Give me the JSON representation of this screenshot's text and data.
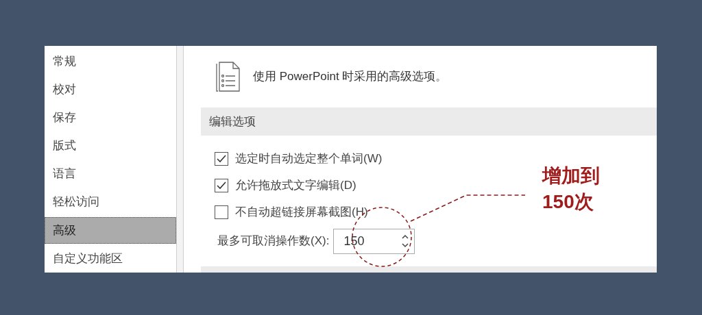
{
  "sidebar": {
    "items": [
      {
        "label": "常规",
        "selected": false
      },
      {
        "label": "校对",
        "selected": false
      },
      {
        "label": "保存",
        "selected": false
      },
      {
        "label": "版式",
        "selected": false
      },
      {
        "label": "语言",
        "selected": false
      },
      {
        "label": "轻松访问",
        "selected": false
      },
      {
        "label": "高级",
        "selected": true
      },
      {
        "label": "自定义功能区",
        "selected": false
      }
    ]
  },
  "panel": {
    "intro": "使用 PowerPoint 时采用的高级选项。",
    "section": {
      "title": "编辑选项",
      "options": [
        {
          "kind": "checkbox",
          "label": "选定时自动选定整个单词(W)",
          "checked": true
        },
        {
          "kind": "checkbox",
          "label": "允许拖放式文字编辑(D)",
          "checked": true
        },
        {
          "kind": "checkbox",
          "label": "不自动超链接屏幕截图(H)",
          "checked": false
        },
        {
          "kind": "spinner",
          "label": "最多可取消操作数(X):",
          "value": "150"
        }
      ]
    }
  },
  "annotation": {
    "lines": [
      "增加到",
      "150次"
    ]
  }
}
